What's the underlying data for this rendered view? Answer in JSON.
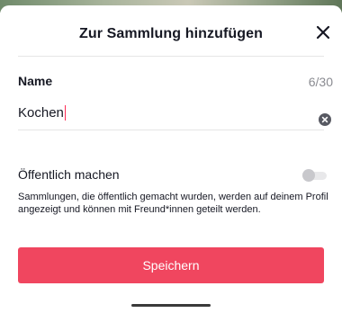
{
  "sheet": {
    "title": "Zur Sammlung hinzufügen",
    "close_icon": "close-icon"
  },
  "name_field": {
    "label": "Name",
    "counter": "6/30",
    "value": "Kochen",
    "clear_icon": "clear-x-circle-icon"
  },
  "public_setting": {
    "label": "Öffentlich machen",
    "enabled": false,
    "description": "Sammlungen, die öffentlich gemacht wurden, werden auf deinem Profil angezeigt und können mit Freund*innen geteilt werden."
  },
  "save_button": {
    "label": "Speichern"
  },
  "colors": {
    "accent": "#f0465f",
    "caret": "#fe2c55",
    "text": "#161823",
    "muted": "#8a8b91"
  }
}
